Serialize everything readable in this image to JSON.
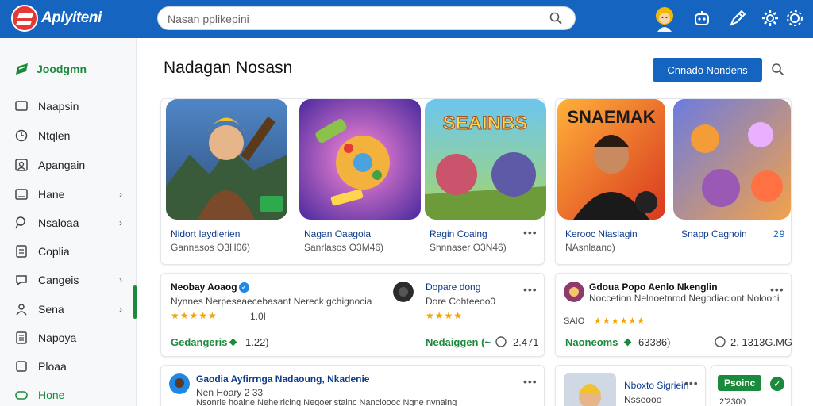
{
  "app": {
    "name": "Aplyiteni"
  },
  "header": {
    "search_placeholder": "Nasan pplikepini",
    "icons": [
      "search-icon",
      "user-avatar",
      "robot-icon",
      "pen-icon",
      "settings-icon",
      "gear-icon"
    ]
  },
  "sidebar": {
    "home_label": "Joodgmn",
    "items": [
      {
        "label": "Naapsin",
        "icon": "laptop-icon",
        "chevron": ""
      },
      {
        "label": "Ntqlen",
        "icon": "clock-icon",
        "chevron": ""
      },
      {
        "label": "Apangain",
        "icon": "people-icon",
        "chevron": ""
      },
      {
        "label": "Hane",
        "icon": "folder-icon",
        "chevron": "›"
      },
      {
        "label": "Nsaloaa",
        "icon": "search-icon",
        "chevron": "›"
      },
      {
        "label": "Coplia",
        "icon": "document-icon",
        "chevron": ""
      },
      {
        "label": "Cangeis",
        "icon": "chat-icon",
        "chevron": "›"
      },
      {
        "label": "Sena",
        "icon": "person-icon",
        "chevron": "›"
      },
      {
        "label": "Napoya",
        "icon": "list-icon",
        "chevron": ""
      },
      {
        "label": "Ploaa",
        "icon": "box-icon",
        "chevron": ""
      },
      {
        "label": "Hone",
        "icon": "gamepad-icon",
        "chevron": ""
      }
    ]
  },
  "main": {
    "title": "Nadagan Nosasn",
    "primary_button": "Cnnado Nondens",
    "featured": [
      {
        "title": "Nidort Iaydierien",
        "subtitle": "Gannasos O3H06)",
        "colors": [
          "#3b6fb5",
          "#6b4a2a"
        ]
      },
      {
        "title": "Nagan Oaagoia",
        "subtitle": "Sanrlasos O3M46)",
        "colors": [
          "#7b3fc8",
          "#f2b23d"
        ]
      },
      {
        "title": "Ragin Coaing",
        "subtitle": "Shnnaser O3N46)",
        "colors": [
          "#46b3e6",
          "#9bc94a"
        ],
        "banner": "SEAINBS"
      },
      {
        "title": "Kerooc Niaslagin",
        "subtitle": "NAsnlaano)",
        "colors": [
          "#e8542a",
          "#1a1a1a"
        ],
        "banner": "SNAEMAK"
      },
      {
        "title": "Snapp Cagnoin",
        "subtitle": "",
        "colors": [
          "#5a74d8",
          "#f08a3c"
        ],
        "corner": "29"
      }
    ],
    "list_cards": [
      {
        "title": "Neobay Aoaog",
        "desc": "Nynnes Nerpeseaecebasant Nereck gchignocia",
        "stars": "★★★★★",
        "rating": "1.0I",
        "category": "Gedangeris",
        "count": "1.22)"
      },
      {
        "title": "Dopare dong",
        "desc": "Dore Cohteeoo0",
        "stars": "★★★★",
        "rating": "",
        "category": "Nedaiggen (~",
        "count": "2.471"
      },
      {
        "title": "Gdoua Popo Aenlo Nkenglin",
        "desc": "Noccetion Nelnoetnrod Negodiaciont Nolooni",
        "stars": "★★★★★★",
        "rating": "SAIO",
        "category": "Naoneoms",
        "count": "63386)",
        "count2": "2. 1313G.MG"
      },
      {
        "title": "Gaodia Ayfirrnga Nadaoung, Nkadenie",
        "desc": "Nen Hoary 2 33",
        "desc2": "Nsonrie hoaine Neheiricing Negoeristainc Nancloooc Ngne nynaing"
      },
      {
        "title": "Nboxto Sigriein",
        "desc": "Nsseooo"
      }
    ],
    "badge": "Psoinc",
    "badge_count": "2ʼ2300"
  }
}
